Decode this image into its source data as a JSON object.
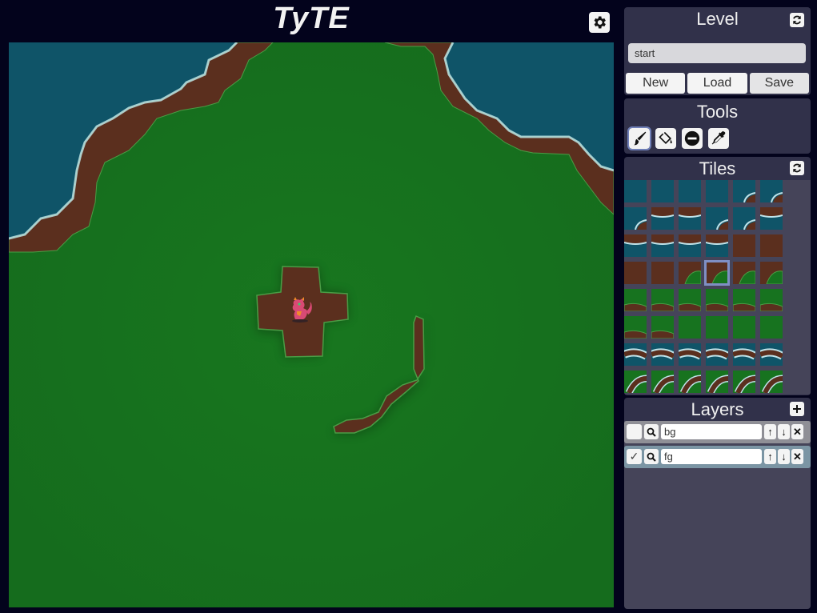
{
  "app": {
    "title": "TyTE"
  },
  "header": {
    "settings_icon": "gear-icon"
  },
  "level_panel": {
    "title": "Level",
    "refresh_icon": "refresh-icon",
    "name_value": "start",
    "buttons": {
      "new": "New",
      "load": "Load",
      "save": "Save"
    }
  },
  "tools_panel": {
    "title": "Tools",
    "tools": [
      {
        "name": "brush",
        "icon": "brush-icon",
        "active": true
      },
      {
        "name": "fill",
        "icon": "bucket-icon",
        "active": false
      },
      {
        "name": "erase",
        "icon": "erase-icon",
        "active": false
      },
      {
        "name": "picker",
        "icon": "eyedropper-icon",
        "active": false
      }
    ]
  },
  "tiles_panel": {
    "title": "Tiles",
    "refresh_icon": "refresh-icon",
    "selected_index": 21,
    "tiles": [
      "water",
      "water",
      "water",
      "water",
      "water-dirt-ne",
      "water-dirt-se",
      "water-dirt-sw",
      "dirt-water-nw",
      "dirt-top-water",
      "water-dirt-e",
      "water-dirt-s",
      "dirt-water-w",
      "dirt-water-sw",
      "dirt-water-c1",
      "dirt-water-c2",
      "dirt-water-c3",
      "dirt",
      "dirt",
      "dirt",
      "dirt",
      "dirt-grass-se",
      "dirt-grass-s",
      "dirt-grass-sw",
      "dirt-grass-ne",
      "grass-dirt-s",
      "grass-dirt-w",
      "grass-dirt-n",
      "grass-dirt-e",
      "grass-dirt-sw",
      "grass-dirt-nw",
      "grass-dirt-ne",
      "grass-dirt-se2",
      "grass",
      "grass",
      "grass",
      "grass",
      "path-water-1",
      "path-water-2",
      "path-water-3",
      "path-water-4",
      "path-water-5",
      "path-water-6",
      "path-grass-1",
      "path-grass-2",
      "path-grass-3",
      "path-grass-4",
      "path-grass-5",
      "path-grass-6"
    ]
  },
  "layers_panel": {
    "title": "Layers",
    "add_icon": "plus-icon",
    "layers": [
      {
        "name": "bg",
        "visible": false,
        "selected": false
      },
      {
        "name": "fg",
        "visible": true,
        "selected": true
      }
    ],
    "controls": {
      "up": "↑",
      "down": "↓",
      "delete": "✕",
      "check": "✓"
    }
  },
  "colors": {
    "background": "#03031c",
    "panel": "#31314a",
    "panel_inner": "#454459",
    "grass": "#17731f",
    "dirt": "#5a2e1c",
    "water": "#0f5266",
    "accent": "#6f7fb8"
  }
}
